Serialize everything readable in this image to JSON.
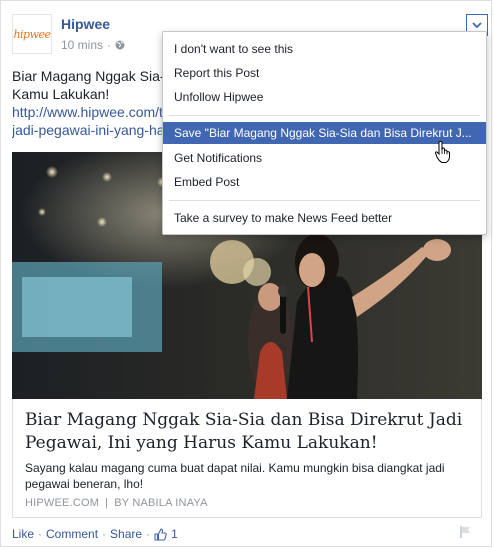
{
  "post": {
    "page_name": "Hipwee",
    "avatar_text": "hipwee",
    "time": "10 mins",
    "text_line1": "Biar Magang Nggak Sia-",
    "text_line2": "Kamu Lakukan!",
    "link_line1": "http://www.hipwee.com/t",
    "link_line2": "jadi-pegawai-ini-yang-ha"
  },
  "card": {
    "title": "Biar Magang Nggak Sia-Sia dan Bisa Direkrut Jadi Pegawai, Ini yang Harus Kamu Lakukan!",
    "description": "Sayang kalau magang cuma buat dapat nilai. Kamu mungkin bisa diangkat jadi pegawai beneran, lho!",
    "source": "HIPWEE.COM",
    "separator": "|",
    "author": "BY NABILA INAYA"
  },
  "actions": {
    "like": "Like",
    "comment": "Comment",
    "share": "Share",
    "like_count": "1",
    "dot": "·"
  },
  "menu": {
    "items": [
      "I don't want to see this",
      "Report this Post",
      "Unfollow Hipwee",
      "Save \"Biar Magang Nggak Sia-Sia dan Bisa Direkrut J...",
      "Get Notifications",
      "Embed Post",
      "Take a survey to make News Feed better"
    ],
    "highlighted_index": 3
  },
  "colors": {
    "link": "#365899",
    "highlight": "#4267b2",
    "muted": "#90949c"
  }
}
